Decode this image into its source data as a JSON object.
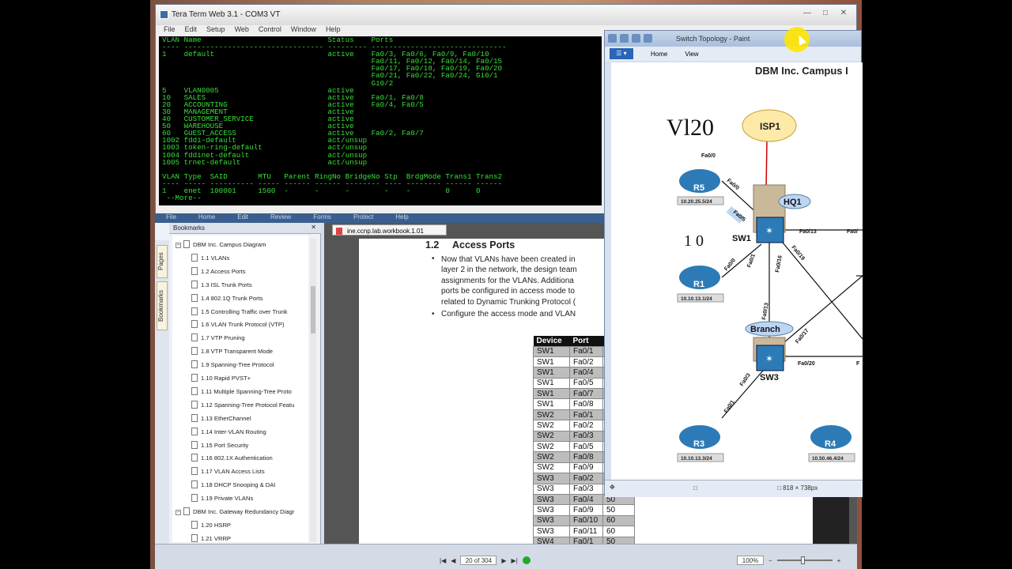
{
  "teraterm": {
    "title": "Tera Term Web 3.1 - COM3 VT",
    "menu": [
      "File",
      "Edit",
      "Setup",
      "Web",
      "Control",
      "Window",
      "Help"
    ],
    "terminal_text": "VLAN Name                             Status    Ports\n---- -------------------------------- --------- -------------------------------\n1    default                          active    Fa0/3, Fa0/6, Fa0/9, Fa0/10\n                                                Fa0/11, Fa0/12, Fa0/14, Fa0/15\n                                                Fa0/17, Fa0/18, Fa0/19, Fa0/20\n                                                Fa0/21, Fa0/22, Fa0/24, Gi0/1\n                                                Gi0/2\n5    VLAN0005                         active\n10   SALES                            active    Fa0/1, Fa0/8\n20   ACCOUNTING                       active    Fa0/4, Fa0/5\n30   MANAGEMENT                       active\n40   CUSTOMER_SERVICE                 active\n50   WAREHOUSE                        active\n60   GUEST_ACCESS                     active    Fa0/2, Fa0/7\n1002 fddi-default                     act/unsup\n1003 token-ring-default               act/unsup\n1004 fddinet-default                  act/unsup\n1005 trnet-default                    act/unsup\n\nVLAN Type  SAID       MTU   Parent RingNo BridgeNo Stp  BrdgMode Trans1 Trans2\n---- ----- ---------- ----- ------ ------ -------- ---- -------- ------ ------\n1    enet  100001     1500  -      -      -        -    -        0      0\n --More--"
  },
  "reader": {
    "ribbon": [
      "File",
      "Home",
      "Edit",
      "Review",
      "Forms",
      "Protect",
      "Help"
    ],
    "side_tabs": {
      "pages": "Pages",
      "bookmarks": "Bookmarks"
    },
    "bookmarks_header": "Bookmarks",
    "bookmarks": [
      {
        "label": "DBM Inc. Campus Diagram",
        "level": 0
      },
      {
        "label": "1.1 VLANs",
        "level": 1
      },
      {
        "label": "1.2 Access Ports",
        "level": 1
      },
      {
        "label": "1.3 ISL Trunk Ports",
        "level": 1
      },
      {
        "label": "1.4 802.1Q Trunk Ports",
        "level": 1
      },
      {
        "label": "1.5 Controlling Traffic over Trunk",
        "level": 1
      },
      {
        "label": "1.6 VLAN Trunk Protocol (VTP)",
        "level": 1
      },
      {
        "label": "1.7 VTP Pruning",
        "level": 1
      },
      {
        "label": "1.8 VTP Transparent Mode",
        "level": 1
      },
      {
        "label": "1.9 Spanning-Tree Protocol",
        "level": 1
      },
      {
        "label": "1.10 Rapid PVST+",
        "level": 1
      },
      {
        "label": "1.11 Multiple Spanning-Tree Proto",
        "level": 1
      },
      {
        "label": "1.12 Spanning-Tree Protocol Featu",
        "level": 1
      },
      {
        "label": "1.13 EtherChannel",
        "level": 1
      },
      {
        "label": "1.14 Inter-VLAN Routing",
        "level": 1
      },
      {
        "label": "1.15 Port Security",
        "level": 1
      },
      {
        "label": "1.16 802.1X Authentication",
        "level": 1
      },
      {
        "label": "1.17 VLAN Access Lists",
        "level": 1
      },
      {
        "label": "1.18 DHCP Snooping & DAI",
        "level": 1
      },
      {
        "label": "1.19 Private VLANs",
        "level": 1
      },
      {
        "label": "DBM Inc. Gateway Redundancy Diagr",
        "level": 0
      },
      {
        "label": "1.20 HSRP",
        "level": 1
      },
      {
        "label": "1.21 VRRP",
        "level": 1
      }
    ],
    "doc_tab": "ine.ccnp.lab.workbook.1.01",
    "section_number": "1.2",
    "section_title": "Access Ports",
    "bullet1_lines": [
      "Now that VLANs have been created in",
      "layer 2 in the network, the design team",
      "assignments for the VLANs.  Additiona",
      "ports be configured in access mode to",
      "related to Dynamic Trunking Protocol ("
    ],
    "bullet2": "Configure the access mode and VLAN",
    "table_headers": [
      "Device",
      "Port",
      ""
    ],
    "table_rows": [
      [
        "SW1",
        "Fa0/1",
        ""
      ],
      [
        "SW1",
        "Fa0/2",
        ""
      ],
      [
        "SW1",
        "Fa0/4",
        ""
      ],
      [
        "SW1",
        "Fa0/5",
        ""
      ],
      [
        "SW1",
        "Fa0/7",
        ""
      ],
      [
        "SW1",
        "Fa0/8",
        ""
      ],
      [
        "SW2",
        "Fa0/1",
        ""
      ],
      [
        "SW2",
        "Fa0/2",
        ""
      ],
      [
        "SW2",
        "Fa0/3",
        ""
      ],
      [
        "SW2",
        "Fa0/5",
        ""
      ],
      [
        "SW2",
        "Fa0/8",
        ""
      ],
      [
        "SW2",
        "Fa0/9",
        ""
      ],
      [
        "SW3",
        "Fa0/2",
        ""
      ],
      [
        "SW3",
        "Fa0/3",
        ""
      ],
      [
        "SW3",
        "Fa0/4",
        "50"
      ],
      [
        "SW3",
        "Fa0/9",
        "50"
      ],
      [
        "SW3",
        "Fa0/10",
        "60"
      ],
      [
        "SW3",
        "Fa0/11",
        "60"
      ],
      [
        "SW4",
        "Fa0/1",
        "50"
      ]
    ],
    "page_indicator": "20 of 304",
    "zoom": "100%"
  },
  "paint": {
    "title": "Switch Topology - Paint",
    "tabs": [
      "Home",
      "View"
    ],
    "diagram_title": "DBM Inc. Campus I",
    "annotation": "Vl20",
    "annotation2": "1 0",
    "nodes": {
      "isp1": "ISP1",
      "r5": "R5",
      "r5_ip": "10.20.25.5/24",
      "r1": "R1",
      "r1_ip": "10.10.13.1/24",
      "r3": "R3",
      "r3_ip": "10.10.13.3/24",
      "r4": "R4",
      "r4_ip": "10.50.46.4/24",
      "hq1": "HQ1",
      "branch": "Branch",
      "sw1": "SW1",
      "sw3": "SW3"
    },
    "port_labels": {
      "p1": "Fa0/0",
      "p2": "Fa0/0",
      "p3": "Fa0/5",
      "p4": "Fa0/13",
      "p5": "Fa0/",
      "p6": "Fa0/1",
      "p7": "Fa0/16",
      "p8": "Fa0/19",
      "p9": "Fa0/0",
      "p10": "Fa0/13",
      "p11": "Fa0/17",
      "p12": "Fa0/20",
      "p13": "F",
      "p14": "Fa0/3",
      "p15": "Fa0/1"
    },
    "dimensions": "818 × 738px"
  },
  "colors": {
    "terminal_fg": "#3adf3a",
    "paint_accent": "#2b64b8",
    "router": "#2c7bb6"
  }
}
